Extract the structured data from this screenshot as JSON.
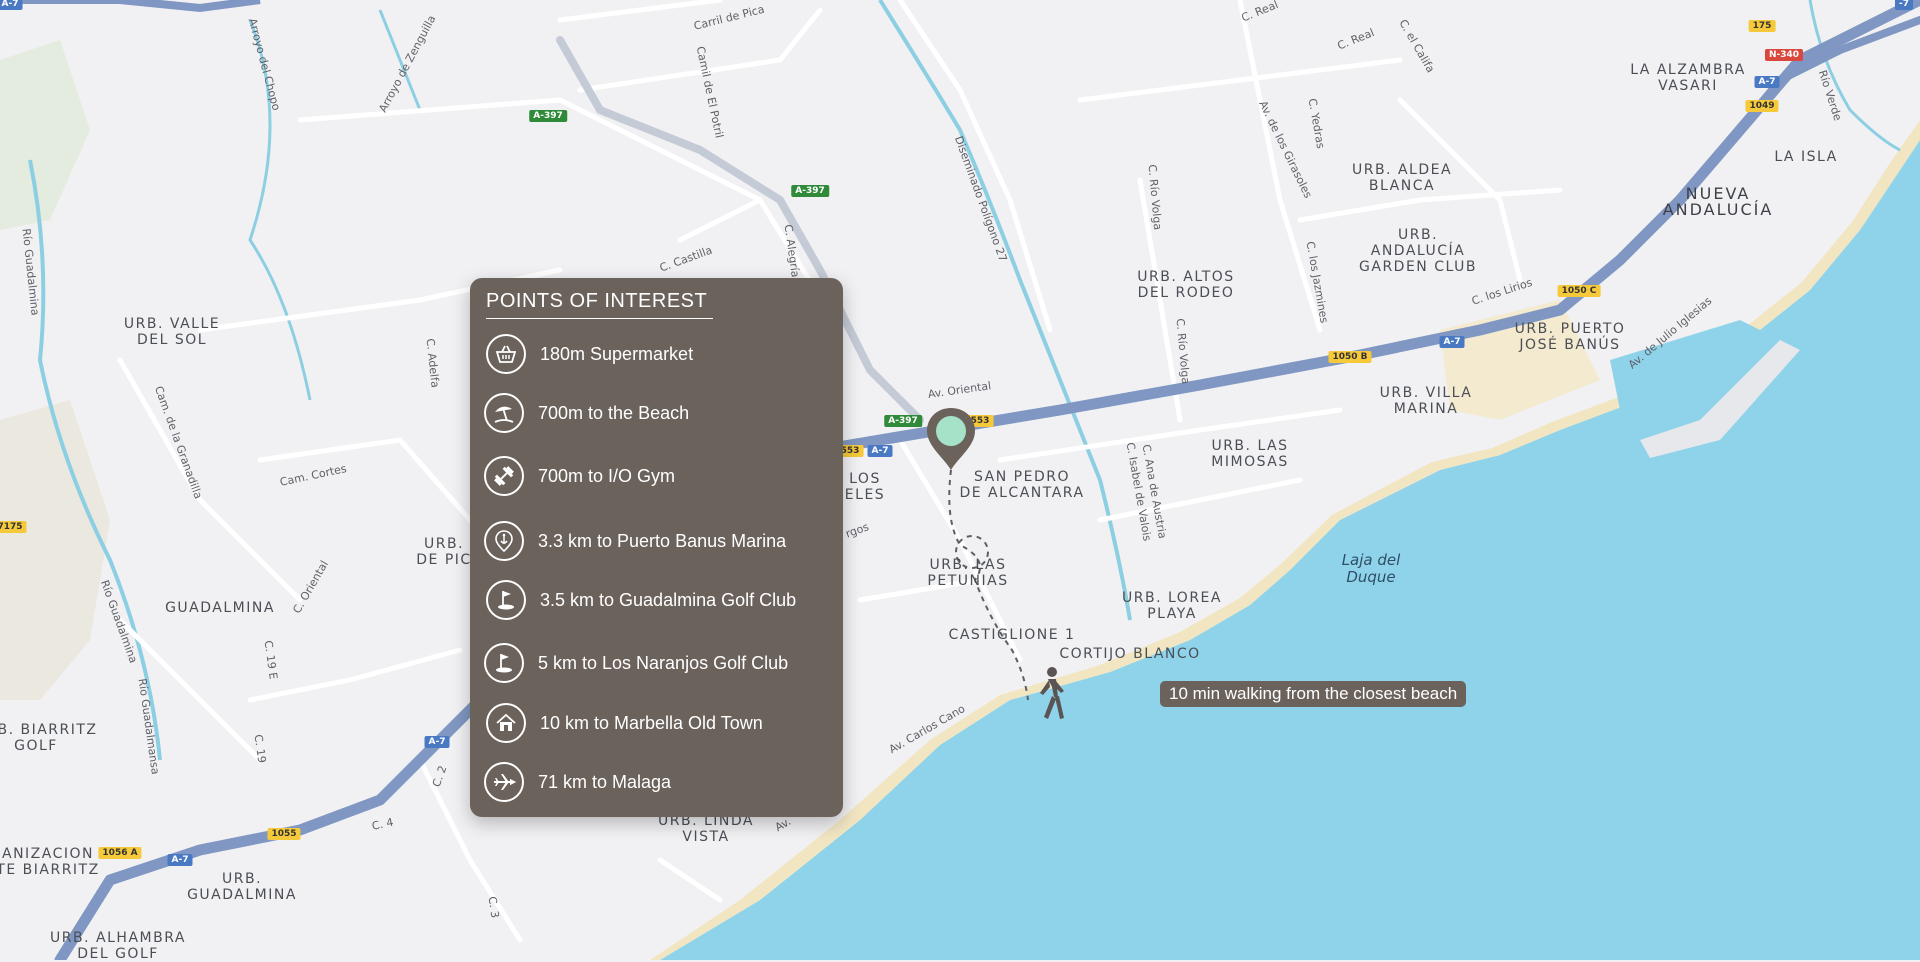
{
  "colors": {
    "sea": "#8fd3ea",
    "land": "#f1f1f3",
    "beach": "#f3e7c4",
    "motorway": "#7f97c2",
    "panel": "#6b625c",
    "marker_fill": "#6b625c",
    "marker_dot": "#a6e2c8"
  },
  "poi_panel": {
    "title": "POINTS OF INTEREST",
    "items": [
      {
        "icon": "basket-icon",
        "text": "180m Supermarket"
      },
      {
        "icon": "beach-umbrella-icon",
        "text": "700m to the Beach"
      },
      {
        "icon": "dumbbell-icon",
        "text": "700m to I/O Gym"
      },
      {
        "icon": "anchor-pin-icon",
        "text": "3.3 km to Puerto Banus Marina"
      },
      {
        "icon": "golf-flag-icon",
        "text": "3.5 km to Guadalmina Golf Club"
      },
      {
        "icon": "golf-flag-icon",
        "text": "5 km to Los Naranjos Golf Club"
      },
      {
        "icon": "house-icon",
        "text": "10 km to Marbella Old Town"
      },
      {
        "icon": "airplane-icon",
        "text": "71 km to Malaga"
      }
    ]
  },
  "walk_callout": "10 min walking from the closest beach",
  "area_labels": [
    "LA ALZAMBRA\nVASARI",
    "LA ISLA",
    "NUEVA\nANDALUCÍA",
    "URB. ALDEA\nBLANCA",
    "URB.\nANDALUCÍA\nGARDEN CLUB",
    "URB. ALTOS\nDEL RODEO",
    "URB. PUERTO\nJOSÉ BANÚS",
    "URB. VILLA\nMARINA",
    "URB. LAS\nMIMOSAS",
    "SAN PEDRO\nDE ALCANTARA",
    "URB. LAS\nPETUNIAS",
    "CASTIGLIONE 1",
    "CORTIJO BLANCO",
    "URB. LOREA\nPLAYA",
    "URB. VALLE\nDEL SOL",
    "GUADALMINA",
    "URB. BIARRITZ\nGOLF",
    "ANIZACION\nTE BIARRITZ",
    "URB.\nGUADALMINA",
    "URB. ALHAMBRA\nDEL GOLF",
    "URB. LINDA\nVISTA",
    "URB.\nDE PIC",
    "LOS\nELES"
  ],
  "water_labels": [
    "Laja del\nDuque"
  ],
  "street_labels": [
    "Carril de Pica",
    "Camil de El Potril",
    "Arroyo de Zenguilla",
    "Arroyo del Chopo",
    "Diseminado Polígono 27",
    "Av. de los Girasoles",
    "C. Real",
    "C. Real",
    "C. el Califa",
    "C. Yedras",
    "C. Río Volga",
    "C. Río Volga",
    "C. los Jazmines",
    "C. los Lirios",
    "Av. de Julio Iglesias",
    "Av. Oriental",
    "C. Castilla",
    "C. Alegría",
    "C. Adelfa",
    "Río Guadalmina",
    "Río Guadalmina",
    "Río Guadalmansa",
    "Cam. de la Granadilla",
    "Cam. Cortes",
    "C. Oriental",
    "C. 19 E",
    "C. 19",
    "C. 4",
    "C. 2",
    "C. 3",
    "Av. Carlos Cano",
    "C. Isabel de Valois",
    "C. Ana de Austria",
    "Río Verde",
    "rgos",
    "Av."
  ],
  "road_shields": [
    "A-397",
    "A-397",
    "A-397",
    "A-7",
    "A-7",
    "A-7",
    "A-7",
    "A-7",
    "A-7",
    "1050 B",
    "1050 C",
    "1049",
    "175",
    "N-340",
    "1055",
    "1056 A",
    "553",
    "553",
    "-7",
    "7175"
  ]
}
